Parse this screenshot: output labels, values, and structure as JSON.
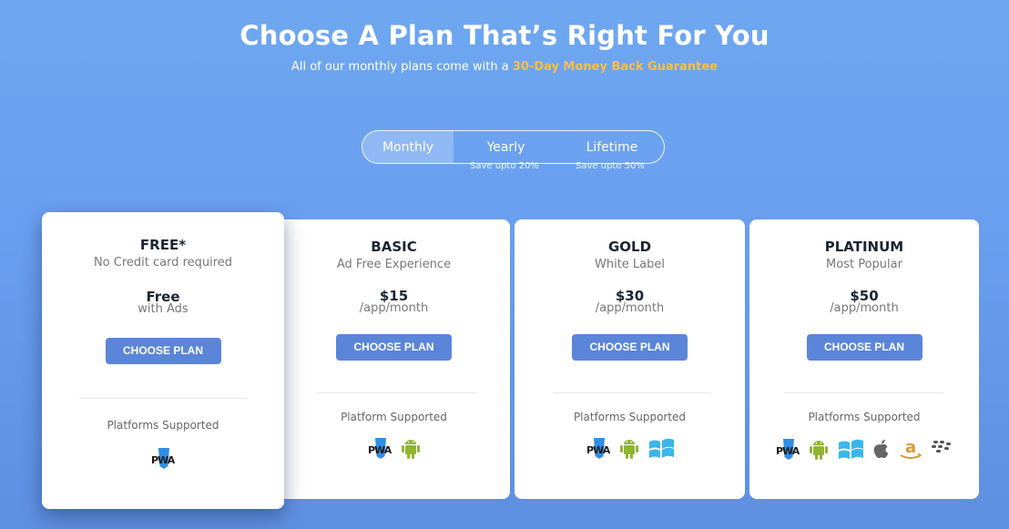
{
  "header": {
    "title": "Choose A Plan That’s Right For You",
    "subtitle_prefix": "All of our monthly plans come with a ",
    "subtitle_highlight": "30-Day Money Back Guarantee"
  },
  "billing_toggle": {
    "options": [
      {
        "label": "Monthly",
        "note": "",
        "active": true
      },
      {
        "label": "Yearly",
        "note": "Save upto 20%",
        "active": false
      },
      {
        "label": "Lifetime",
        "note": "Save upto 50%",
        "active": false
      }
    ]
  },
  "colors": {
    "accent": "#5b85d9",
    "highlight": "#f6c043",
    "background": "#6ea7f0"
  },
  "plans": [
    {
      "name": "FREE*",
      "description": "No Credit card required",
      "price": "Free",
      "period": "with Ads",
      "button": "CHOOSE PLAN",
      "platforms_label": "Platforms Supported",
      "platforms": [
        "pwa-icon"
      ]
    },
    {
      "name": "BASIC",
      "description": "Ad Free Experience",
      "price": "$15",
      "period": "/app/month",
      "button": "CHOOSE PLAN",
      "platforms_label": "Platform Supported",
      "platforms": [
        "pwa-icon",
        "android-icon"
      ]
    },
    {
      "name": "GOLD",
      "description": "White Label",
      "price": "$30",
      "period": "/app/month",
      "button": "CHOOSE PLAN",
      "platforms_label": "Platforms Supported",
      "platforms": [
        "pwa-icon",
        "android-icon",
        "windows-icon"
      ]
    },
    {
      "name": "PLATINUM",
      "description": "Most Popular",
      "price": "$50",
      "period": "/app/month",
      "button": "CHOOSE PLAN",
      "platforms_label": "Platforms Supported",
      "platforms": [
        "pwa-icon",
        "android-icon",
        "windows-icon",
        "apple-icon",
        "amazon-icon",
        "blackberry-icon"
      ]
    }
  ]
}
